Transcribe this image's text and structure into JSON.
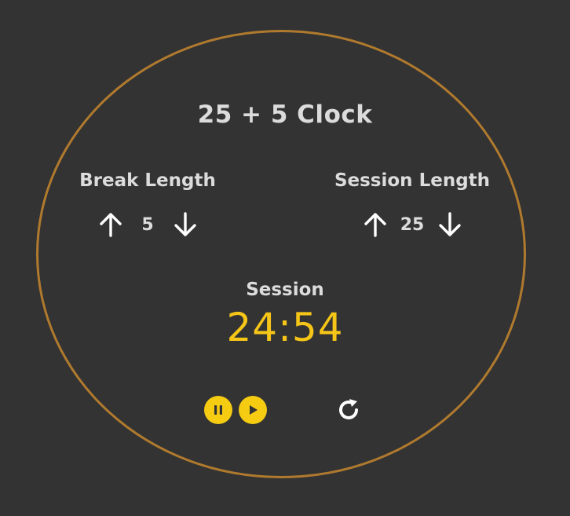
{
  "app": {
    "title": "25 + 5 Clock"
  },
  "break": {
    "label": "Break Length",
    "value": "5",
    "increment_icon": "arrow-up-icon",
    "decrement_icon": "arrow-down-icon"
  },
  "session": {
    "label": "Session Length",
    "value": "25",
    "increment_icon": "arrow-up-icon",
    "decrement_icon": "arrow-down-icon"
  },
  "timer": {
    "label": "Session",
    "time_left": "24:54"
  },
  "controls": {
    "pause_icon": "pause-icon",
    "play_icon": "play-icon",
    "reset_icon": "refresh-icon"
  },
  "colors": {
    "background": "#333333",
    "ring": "#b07a2e",
    "accent": "#f5cc12",
    "text": "#dcdcdc"
  }
}
